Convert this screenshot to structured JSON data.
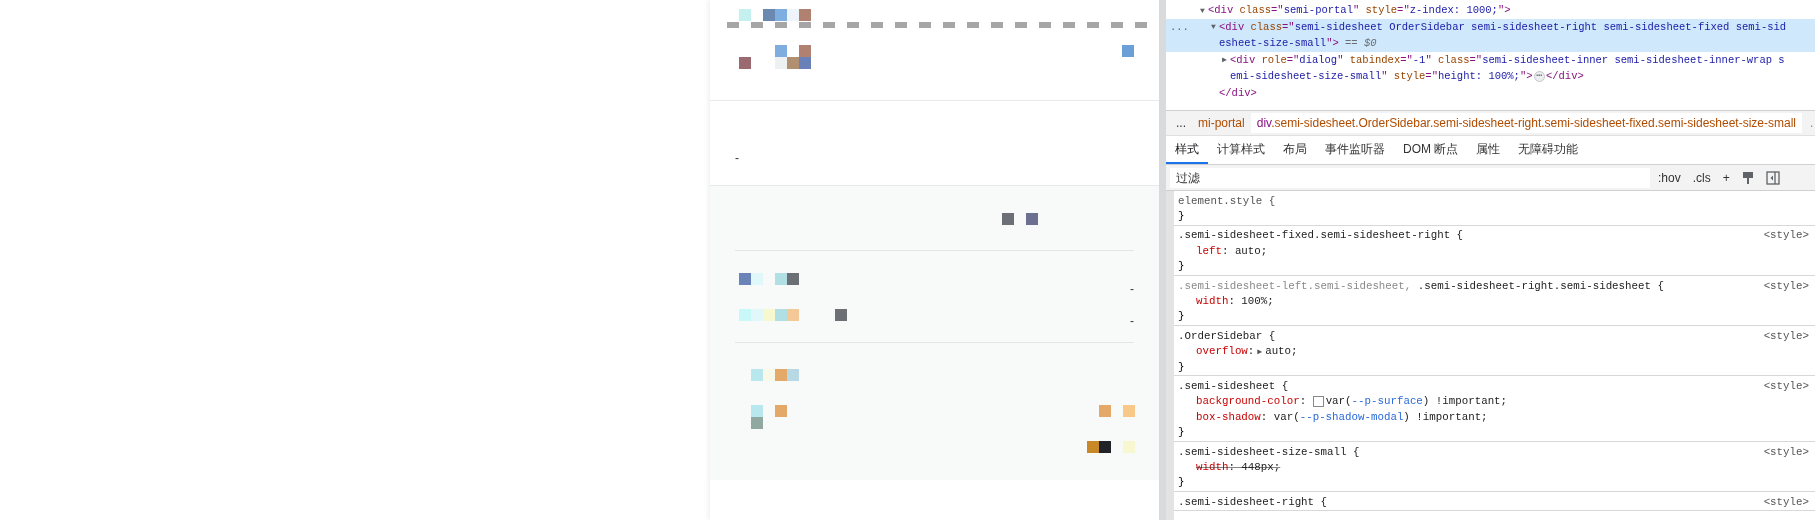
{
  "side_sheet": {
    "note_value": "-",
    "rows": [
      {
        "value": "-"
      },
      {
        "value": "-"
      }
    ]
  },
  "devtools": {
    "dom_tree": [
      {
        "expander": "▼",
        "lines": [
          [
            {
              "kind": "tag",
              "text": "<div"
            },
            {
              "kind": "attr",
              "text": " class"
            },
            {
              "kind": "tag",
              "text": "=\""
            },
            {
              "kind": "value",
              "text": "semi-portal"
            },
            {
              "kind": "tag",
              "text": "\""
            },
            {
              "kind": "attr",
              "text": " style"
            },
            {
              "kind": "tag",
              "text": "=\""
            },
            {
              "kind": "value",
              "text": "z-index: 1000;"
            },
            {
              "kind": "tag",
              "text": "\">"
            }
          ]
        ],
        "children": [
          {
            "gutter": "...",
            "selected": true,
            "expander": "▼",
            "lines": [
              [
                {
                  "kind": "tag",
                  "text": "<div"
                },
                {
                  "kind": "attr",
                  "text": " class"
                },
                {
                  "kind": "tag",
                  "text": "=\""
                },
                {
                  "kind": "value",
                  "text": "semi-sidesheet OrderSidebar semi-sidesheet-right semi-sidesheet-fixed semi-sid"
                }
              ],
              [
                {
                  "kind": "value",
                  "text": "esheet-size-small"
                },
                {
                  "kind": "tag",
                  "text": "\">"
                },
                {
                  "kind": "muted",
                  "text": " == $0"
                }
              ]
            ],
            "children": [
              {
                "selected": false,
                "expander": "▶",
                "lines": [
                  [
                    {
                      "kind": "tag",
                      "text": "<div"
                    },
                    {
                      "kind": "attr",
                      "text": " role"
                    },
                    {
                      "kind": "tag",
                      "text": "=\""
                    },
                    {
                      "kind": "value",
                      "text": "dialog"
                    },
                    {
                      "kind": "tag",
                      "text": "\""
                    },
                    {
                      "kind": "attr",
                      "text": " tabindex"
                    },
                    {
                      "kind": "tag",
                      "text": "=\""
                    },
                    {
                      "kind": "value",
                      "text": "-1"
                    },
                    {
                      "kind": "tag",
                      "text": "\""
                    },
                    {
                      "kind": "attr",
                      "text": " class"
                    },
                    {
                      "kind": "tag",
                      "text": "=\""
                    },
                    {
                      "kind": "value",
                      "text": "semi-sidesheet-inner semi-sidesheet-inner-wrap s"
                    }
                  ],
                  [
                    {
                      "kind": "value",
                      "text": "emi-sidesheet-size-small"
                    },
                    {
                      "kind": "tag",
                      "text": "\""
                    },
                    {
                      "kind": "attr",
                      "text": " style"
                    },
                    {
                      "kind": "tag",
                      "text": "=\""
                    },
                    {
                      "kind": "value",
                      "text": "height: 100%;"
                    },
                    {
                      "kind": "tag",
                      "text": "\">"
                    },
                    {
                      "kind": "badge",
                      "text": "⋯"
                    },
                    {
                      "kind": "tag",
                      "text": "</div>"
                    }
                  ]
                ]
              }
            ],
            "close": [
              {
                "kind": "tag",
                "text": "</div>"
              }
            ]
          }
        ]
      }
    ],
    "breadcrumbs": {
      "lead": "...",
      "items": [
        {
          "parts": [
            {
              "kind": "class",
              "text": "mi-portal"
            }
          ],
          "selected": false
        },
        {
          "parts": [
            {
              "kind": "tag",
              "text": "div"
            },
            {
              "kind": "class",
              "text": ".semi-sidesheet.OrderSidebar.semi-sidesheet-right.semi-sidesheet-fixed.semi-sidesheet-size-small"
            }
          ],
          "selected": true
        }
      ],
      "trail": "."
    },
    "tabs": [
      {
        "label": "样式",
        "selected": true
      },
      {
        "label": "计算样式",
        "selected": false
      },
      {
        "label": "布局",
        "selected": false
      },
      {
        "label": "事件监听器",
        "selected": false
      },
      {
        "label": "DOM 断点",
        "selected": false
      },
      {
        "label": "属性",
        "selected": false
      },
      {
        "label": "无障碍功能",
        "selected": false
      }
    ],
    "filter": {
      "placeholder": "过滤",
      "buttons": [
        ":hov",
        ".cls",
        "+"
      ]
    },
    "rules": [
      {
        "selector": [
          {
            "kind": "sel-grey",
            "text": "element.style {"
          }
        ],
        "close": "}"
      },
      {
        "selector": [
          {
            "kind": "sel",
            "text": ".semi-sidesheet-fixed.semi-sidesheet-right {"
          }
        ],
        "source": "<style>",
        "declarations": [
          {
            "struck": false,
            "tokens": [
              {
                "kind": "prop",
                "text": "left"
              },
              {
                "kind": "text",
                "text": ": auto;"
              }
            ]
          }
        ],
        "close": "}"
      },
      {
        "selector": [
          {
            "kind": "sel-dim",
            "text": ".semi-sidesheet-left.semi-sidesheet, "
          },
          {
            "kind": "sel",
            "text": ".semi-sidesheet-right.semi-sidesheet {"
          }
        ],
        "source": "<style>",
        "declarations": [
          {
            "struck": false,
            "tokens": [
              {
                "kind": "prop",
                "text": "width"
              },
              {
                "kind": "text",
                "text": ": 100%;"
              }
            ]
          }
        ],
        "close": "}"
      },
      {
        "selector": [
          {
            "kind": "sel",
            "text": ".OrderSidebar {"
          }
        ],
        "source": "<style>",
        "declarations": [
          {
            "struck": false,
            "tokens": [
              {
                "kind": "prop",
                "text": "overflow"
              },
              {
                "kind": "text",
                "text": ":"
              },
              {
                "kind": "expander",
                "text": "▶"
              },
              {
                "kind": "text",
                "text": "auto;"
              }
            ]
          }
        ],
        "close": "}"
      },
      {
        "selector": [
          {
            "kind": "sel",
            "text": ".semi-sidesheet {"
          }
        ],
        "source": "<style>",
        "declarations": [
          {
            "struck": false,
            "tokens": [
              {
                "kind": "prop",
                "text": "background-color"
              },
              {
                "kind": "text",
                "text": ": "
              },
              {
                "kind": "swatch"
              },
              {
                "kind": "text",
                "text": "var("
              },
              {
                "kind": "var",
                "text": "--p-surface"
              },
              {
                "kind": "text",
                "text": ") !important;"
              }
            ]
          },
          {
            "struck": false,
            "tokens": [
              {
                "kind": "prop",
                "text": "box-shadow"
              },
              {
                "kind": "text",
                "text": ": var("
              },
              {
                "kind": "var",
                "text": "--p-shadow-modal"
              },
              {
                "kind": "text",
                "text": ") !important;"
              }
            ]
          }
        ],
        "close": "}"
      },
      {
        "selector": [
          {
            "kind": "sel",
            "text": ".semi-sidesheet-size-small {"
          }
        ],
        "source": "<style>",
        "declarations": [
          {
            "struck": true,
            "tokens": [
              {
                "kind": "prop",
                "text": "width"
              },
              {
                "kind": "text",
                "text": ": 448px;"
              }
            ]
          }
        ],
        "close": "}"
      },
      {
        "selector": [
          {
            "kind": "sel",
            "text": ".semi-sidesheet-right {"
          }
        ],
        "source": "<style>"
      }
    ]
  }
}
